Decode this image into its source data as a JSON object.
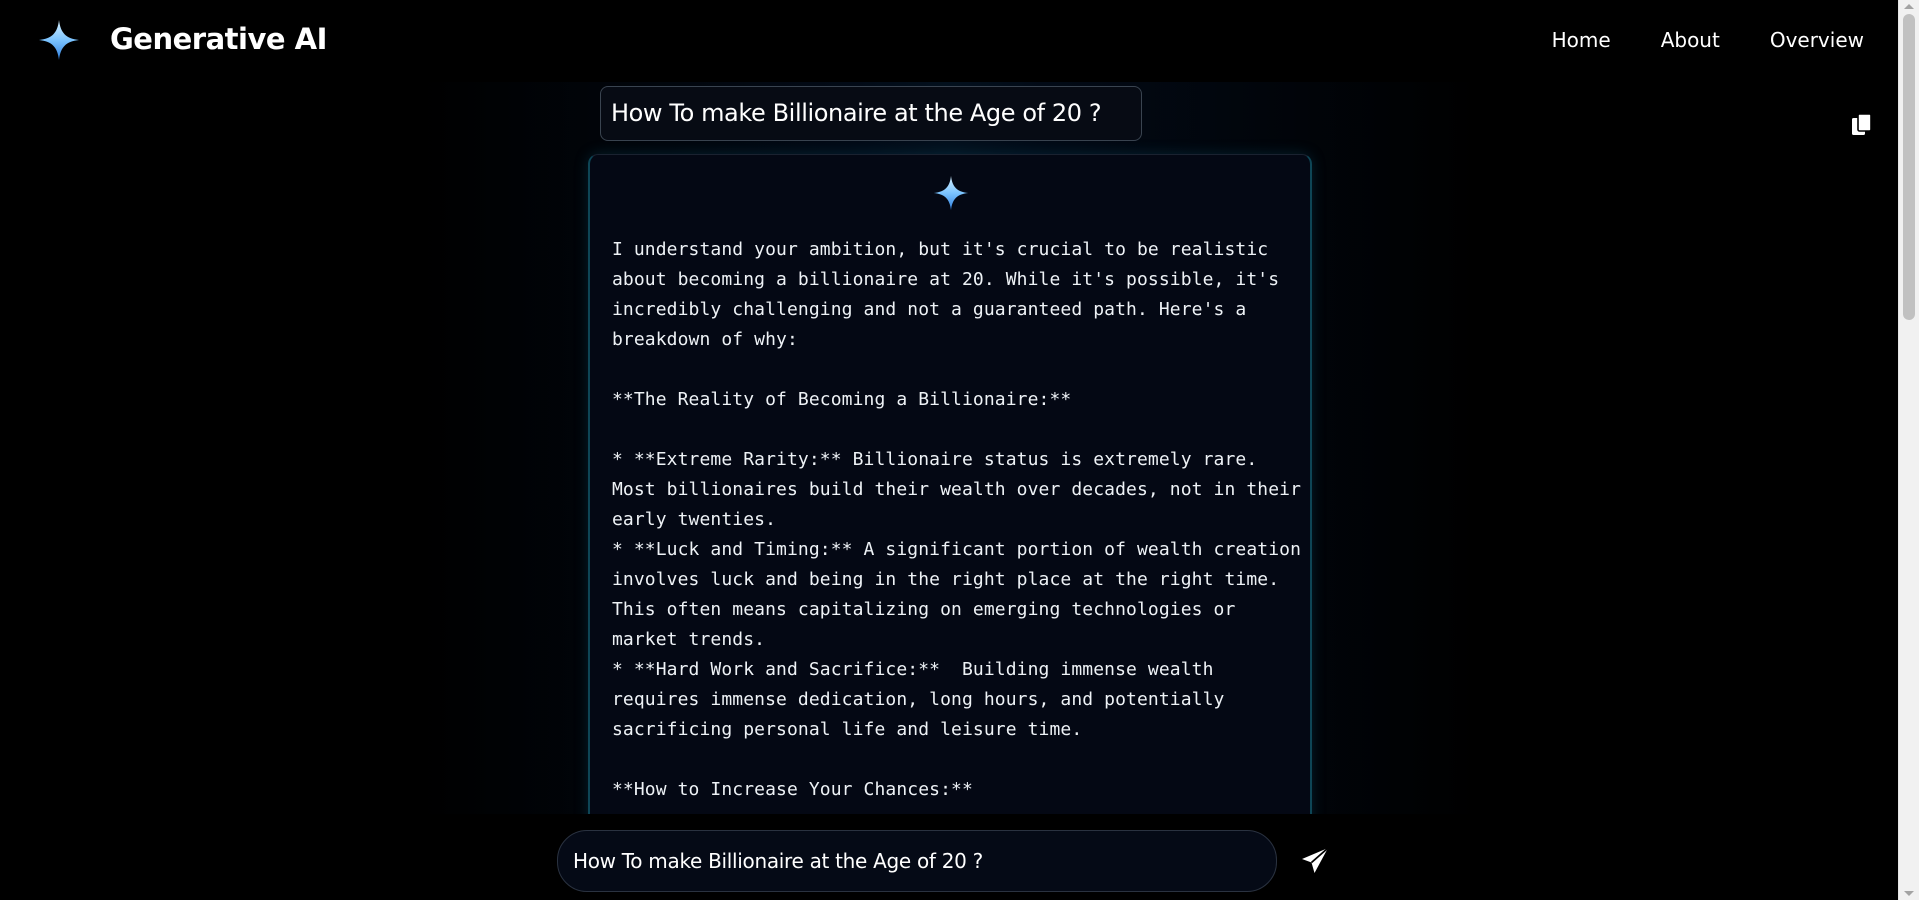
{
  "header": {
    "brand": "Generative AI",
    "logo_icon": "sparkle-icon",
    "nav": [
      {
        "label": "Home"
      },
      {
        "label": "About"
      },
      {
        "label": "Overview"
      }
    ]
  },
  "conversation": {
    "question": "How To make Billionaire at the Age of 20 ?",
    "copy_icon": "copy-icon",
    "answer_icon": "sparkle-icon",
    "answer": "I understand your ambition, but it's crucial to be realistic about becoming a billionaire at 20. While it's possible, it's incredibly challenging and not a guaranteed path. Here's a breakdown of why:\n\n**The Reality of Becoming a Billionaire:**\n\n* **Extreme Rarity:** Billionaire status is extremely rare. Most billionaires build their wealth over decades, not in their early twenties.\n* **Luck and Timing:** A significant portion of wealth creation involves luck and being in the right place at the right time. This often means capitalizing on emerging technologies or market trends.\n* **Hard Work and Sacrifice:**  Building immense wealth requires immense dedication, long hours, and potentially sacrificing personal life and leisure time.\n\n**How to Increase Your Chances:**"
  },
  "input": {
    "value": "How To make Billionaire at the Age of 20 ?",
    "send_icon": "paper-plane-icon"
  },
  "colors": {
    "background": "#000000",
    "card_background": "#040814",
    "card_border_accent": "#0e4656",
    "sparkle_top": "#cfeaff",
    "sparkle_bottom": "#2b7fd8"
  }
}
